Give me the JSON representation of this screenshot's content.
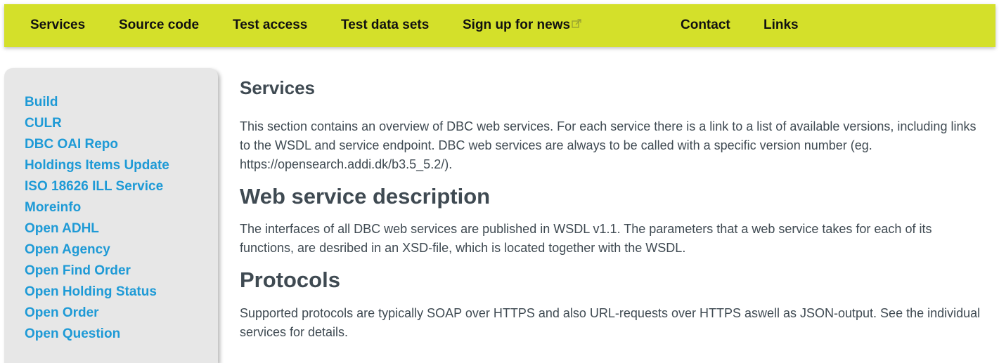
{
  "nav": {
    "items": [
      {
        "label": "Services"
      },
      {
        "label": "Source code"
      },
      {
        "label": "Test access"
      },
      {
        "label": "Test data sets"
      },
      {
        "label": "Sign up for news",
        "icon": "external-link-icon"
      },
      {
        "label": "Contact"
      },
      {
        "label": "Links"
      }
    ]
  },
  "sidebar": {
    "items": [
      {
        "label": "Build"
      },
      {
        "label": "CULR"
      },
      {
        "label": "DBC OAI Repo"
      },
      {
        "label": "Holdings Items Update"
      },
      {
        "label": "ISO 18626 ILL Service"
      },
      {
        "label": "Moreinfo"
      },
      {
        "label": "Open ADHL"
      },
      {
        "label": "Open Agency"
      },
      {
        "label": "Open Find Order"
      },
      {
        "label": "Open Holding Status"
      },
      {
        "label": "Open Order"
      },
      {
        "label": "Open Question"
      }
    ]
  },
  "main": {
    "title": "Services",
    "intro": "This section contains an overview of DBC web services. For each service there is a link to a list of available versions, including links to the WSDL and service endpoint. DBC web services are always to be called with a specific version number (eg. https://opensearch.addi.dk/b3.5_5.2/).",
    "sections": [
      {
        "heading": "Web service description",
        "text": "The interfaces of all DBC web services are published in WSDL v1.1. The parameters that a web service takes for each of its functions, are desribed in an XSD-file, which is located together with the WSDL."
      },
      {
        "heading": "Protocols",
        "text": "Supported protocols are typically SOAP over HTTPS and also URL-requests over HTTPS aswell as JSON-output. See the individual services for details."
      }
    ]
  },
  "colors": {
    "nav_background": "#d4e02a",
    "sidebar_background": "#e7e7e7",
    "link": "#1e9ad6",
    "text": "#3f4a52"
  }
}
